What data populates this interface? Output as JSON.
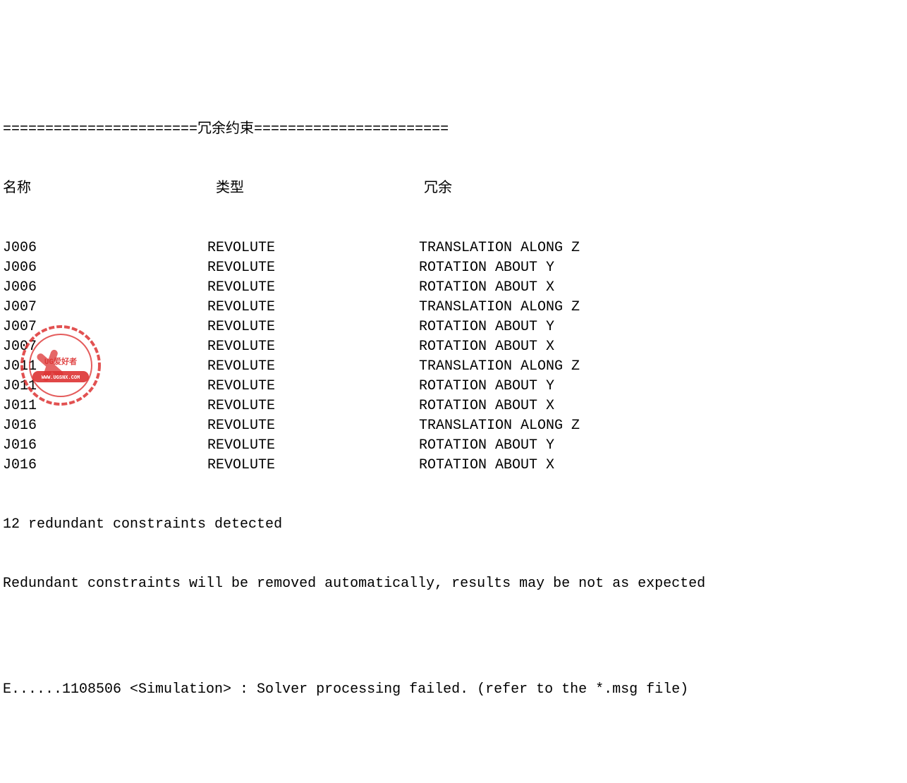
{
  "header": {
    "divider_left": "=======================",
    "title": "冗余约束",
    "divider_right": "======================="
  },
  "columns": {
    "name": "名称",
    "type": "类型",
    "redundant": "冗余"
  },
  "rows": [
    {
      "name": "J006",
      "type": "REVOLUTE",
      "redundant": "TRANSLATION ALONG Z"
    },
    {
      "name": "J006",
      "type": "REVOLUTE",
      "redundant": "ROTATION ABOUT Y"
    },
    {
      "name": "J006",
      "type": "REVOLUTE",
      "redundant": "ROTATION ABOUT X"
    },
    {
      "name": "J007",
      "type": "REVOLUTE",
      "redundant": "TRANSLATION ALONG Z"
    },
    {
      "name": "J007",
      "type": "REVOLUTE",
      "redundant": "ROTATION ABOUT Y"
    },
    {
      "name": "J007",
      "type": "REVOLUTE",
      "redundant": "ROTATION ABOUT X"
    },
    {
      "name": "J011",
      "type": "REVOLUTE",
      "redundant": "TRANSLATION ALONG Z"
    },
    {
      "name": "J011",
      "type": "REVOLUTE",
      "redundant": "ROTATION ABOUT Y"
    },
    {
      "name": "J011",
      "type": "REVOLUTE",
      "redundant": "ROTATION ABOUT X"
    },
    {
      "name": "J016",
      "type": "REVOLUTE",
      "redundant": "TRANSLATION ALONG Z"
    },
    {
      "name": "J016",
      "type": "REVOLUTE",
      "redundant": "ROTATION ABOUT Y"
    },
    {
      "name": "J016",
      "type": "REVOLUTE",
      "redundant": "ROTATION ABOUT X"
    }
  ],
  "messages": {
    "detected": "12 redundant constraints detected",
    "removed": "Redundant constraints will be removed automatically, results may be not as expected",
    "error": "E......1108506 <Simulation> : Solver processing failed. (refer to the *.msg file)"
  },
  "watermark": {
    "text1": "UG爱好者",
    "text2": "WWW.UGSNX.COM"
  }
}
